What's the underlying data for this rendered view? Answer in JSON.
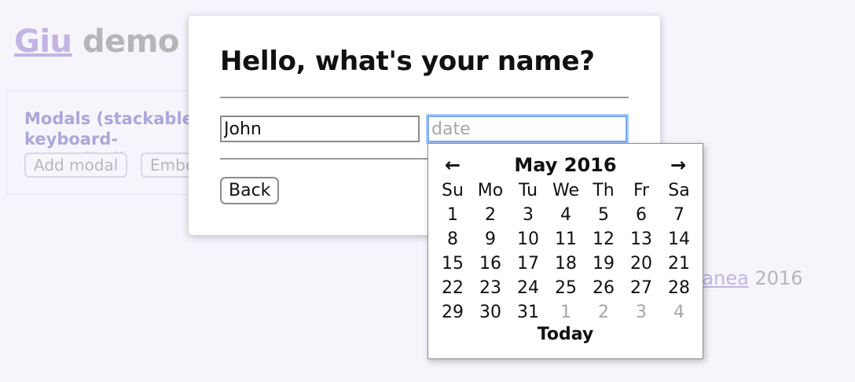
{
  "background": {
    "title_link": "Giu",
    "title_rest": " demo",
    "section_title": "Modals (stackable, keyboard-controlled)",
    "buttons": [
      "Add modal",
      "Embe"
    ],
    "footer_link": "Panea",
    "footer_year": "2016"
  },
  "modal": {
    "title": "Hello, what's your name?",
    "name_value": "John",
    "date_placeholder": "date",
    "back_label": "Back"
  },
  "calendar": {
    "prev_icon": "←",
    "next_icon": "→",
    "month_label": "May 2016",
    "weekdays": [
      "Su",
      "Mo",
      "Tu",
      "We",
      "Th",
      "Fr",
      "Sa"
    ],
    "weeks": [
      [
        "1",
        "2",
        "3",
        "4",
        "5",
        "6",
        "7"
      ],
      [
        "8",
        "9",
        "10",
        "11",
        "12",
        "13",
        "14"
      ],
      [
        "15",
        "16",
        "17",
        "18",
        "19",
        "20",
        "21"
      ],
      [
        "22",
        "23",
        "24",
        "25",
        "26",
        "27",
        "28"
      ],
      [
        "29",
        "30",
        "31",
        "1",
        "2",
        "3",
        "4"
      ]
    ],
    "other_month_from_last_week_index": 3,
    "today_label": "Today"
  }
}
